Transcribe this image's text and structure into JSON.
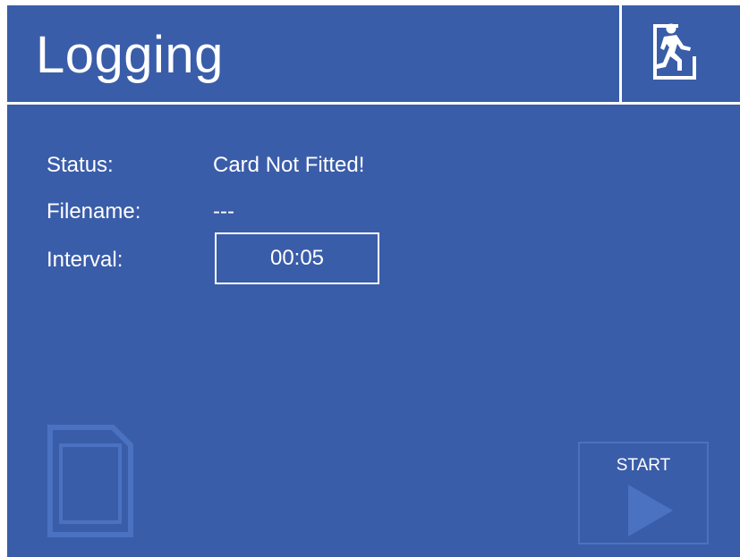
{
  "header": {
    "title": "Logging",
    "exit_icon": "emergency-exit-icon"
  },
  "fields": {
    "status": {
      "label": "Status:",
      "value": "Card Not Fitted!"
    },
    "filename": {
      "label": "Filename:",
      "value": "---"
    },
    "interval": {
      "label": "Interval:",
      "value": "00:05"
    }
  },
  "footer": {
    "sd_card_icon": "sd-card-icon",
    "start_label": "START",
    "start_icon": "play-arrow-icon"
  },
  "colors": {
    "background": "#3a5da9",
    "text": "#ffffff",
    "disabled_icon": "#4a72c1"
  }
}
